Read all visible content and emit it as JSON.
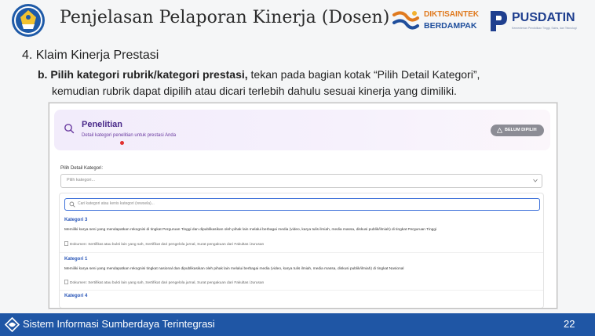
{
  "header": {
    "title": "Penjelasan Pelaporan Kinerja (Dosen)",
    "brand_top": "DIKTISAINTEK",
    "brand_bottom": "BERDAMPAK",
    "brand2_name": "PUSDATIN",
    "brand2_tagline": "Kementerian Pendidikan Tinggi, Sains, dan Teknologi"
  },
  "content": {
    "heading": "4. Klaim Kinerja Prestasi",
    "step_bold": "b. Pilih kategori rubrik/kategori prestasi,",
    "step_rest": " tekan pada bagian kotak “Pilih Detail Kategori”,",
    "step_line2": "kemudian rubrik dapat dipilih atau dicari terlebih dahulu sesuai kinerja yang dimiliki."
  },
  "app": {
    "panel_title": "Penelitian",
    "panel_subtitle": "Detail kategori penelitian untuk prestasi Anda",
    "status_badge": "BELUM DIPILIH",
    "field_label": "Pilih Detail Kategori:",
    "select_placeholder": "Pilih kategori...",
    "search_placeholder": "Cari kategori atau kenis kategori (rewsela)...",
    "options": [
      {
        "title": "Kategori 3",
        "desc": "Memiliki karya seni yang mendapatkan rekognisi di tingkat Perguruan Tinggi dan dipublikasikan oleh pihak lain melalui berbagai media (video, karya tulis ilmiah, media massa, diskusi publik/ilmiah) di tingkat Perguruan Tinggi",
        "docs": "Dokumen: Sertifikat atau bukti lain yang sah, Sertifikat dari pengelola jurnal, Surat pengakuan dari Fakultas /Jurusan"
      },
      {
        "title": "Kategori 1",
        "desc": "Memiliki karya seni yang mendapatkan rekognisi tingkat nasional dan dipublikasikan oleh pihak lain melalui berbagai media (video, karya tulis ilmiah, media massa, diskusi publik/ilmiah) di tingkat Nasional",
        "docs": "Dokumen: Sertifikat atau bukti lain yang sah, Sertifikat dari pengelola jurnal, Surat pengakuan dari Fakultas /Jurusan"
      },
      {
        "title": "Kategori 4",
        "desc": "",
        "docs": ""
      }
    ]
  },
  "footer": {
    "system_name": "Sistem Informasi Sumberdaya Terintegrasi",
    "page_number": "22"
  },
  "colors": {
    "footer_bg": "#1f56a5",
    "panel_title": "#4a2a8a",
    "option_title": "#2956b8",
    "search_focus": "#3b6fd9",
    "badge_bg": "#8c8c95"
  },
  "icons": {
    "header_logo": "university-logo-icon",
    "brand1": "diktisaintek-logo-icon",
    "brand2": "pusdatin-logo-icon",
    "panel": "search-icon",
    "badge": "warning-icon",
    "select": "chevron-down-icon",
    "dropdown_search": "search-icon",
    "doc": "document-icon",
    "footer": "siakad-logo-icon"
  }
}
